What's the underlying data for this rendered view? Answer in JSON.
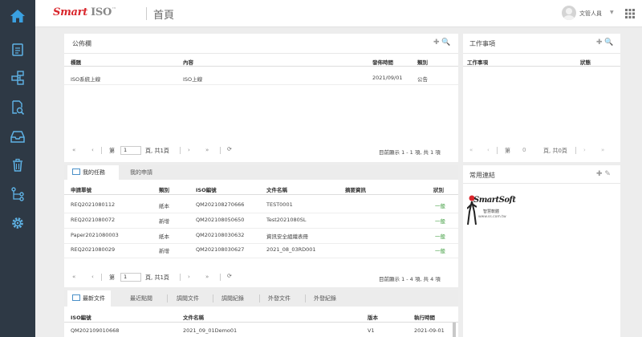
{
  "header": {
    "logo_text": "Smart",
    "logo_iso": "ISO",
    "logo_tm": "™",
    "page_title": "首頁",
    "user_name": "文管人員",
    "user_caret": "▼"
  },
  "sidebar": {
    "icons": [
      "home-icon",
      "document-list-icon",
      "org-chart-icon",
      "document-search-icon",
      "inbox-icon",
      "trash-icon",
      "workflow-icon",
      "gear-icon"
    ],
    "active_color": "#3aa0e0",
    "icon_color": "#5fb3e6"
  },
  "bulletin": {
    "title": "公佈欄",
    "tools": "✚ 🔍",
    "columns": [
      "標題",
      "內容",
      "發佈時間",
      "類別"
    ],
    "rows": [
      [
        "ISO系統上線",
        "ISO上線",
        "2021/09/01",
        "公告"
      ]
    ],
    "pager": {
      "first": "«",
      "prev": "‹",
      "page_label": "第",
      "page_value": "1",
      "page_suffix": "頁, 共1頁",
      "next": "›",
      "last": "»",
      "refresh": "⟳",
      "summary": "目前顯示 1 - 1 項, 共 1 項"
    }
  },
  "work": {
    "title": "工作事項",
    "tools": "✚ 🔍",
    "columns": [
      "工作事項",
      "狀態"
    ],
    "pager": {
      "first": "«",
      "prev": "‹",
      "page_label": "第",
      "page_value": "0",
      "page_suffix": "頁, 共0頁",
      "next": "›",
      "last": "»"
    }
  },
  "tasks": {
    "tabs": [
      "我的任務",
      "我的申請"
    ],
    "columns": [
      "申請單號",
      "類別",
      "ISO編號",
      "文件名稱",
      "摘要資訊",
      "狀別"
    ],
    "rows": [
      [
        "REQ2021080112",
        "紙本",
        "QM202108270666",
        "TEST0001",
        "",
        "一般"
      ],
      [
        "REQ2021080072",
        "新增",
        "QM202108050650",
        "Test2021080SL",
        "",
        "一般"
      ],
      [
        "Paper2021080003",
        "紙本",
        "QM202108030632",
        "資訊安全組織表冊",
        "",
        "一般"
      ],
      [
        "REQ2021080029",
        "新增",
        "QM202108030627",
        "2021_08_03RD001",
        "",
        "一般"
      ]
    ],
    "pager": {
      "first": "«",
      "prev": "‹",
      "page_label": "第",
      "page_value": "1",
      "page_suffix": "頁, 共1頁",
      "next": "›",
      "last": "»",
      "refresh": "⟳",
      "summary": "目前顯示 1 - 4 項, 共 4 項"
    }
  },
  "links": {
    "title": "常用連結",
    "tools": "✚ ✎",
    "logo_text": "SmartSoft",
    "logo_sub": "智慧軟體",
    "logo_url": "www.ss.com.tw"
  },
  "docs": {
    "tabs": [
      "最新文件",
      "最近點閱",
      "調閱文件",
      "調閱紀錄",
      "外發文件",
      "外發紀錄"
    ],
    "columns": [
      "ISO編號",
      "文件名稱",
      "版本",
      "執行時間"
    ],
    "rows": [
      [
        "QM202109010668",
        "2021_09_01Demo01",
        "V1",
        "2021-09-01"
      ]
    ]
  }
}
